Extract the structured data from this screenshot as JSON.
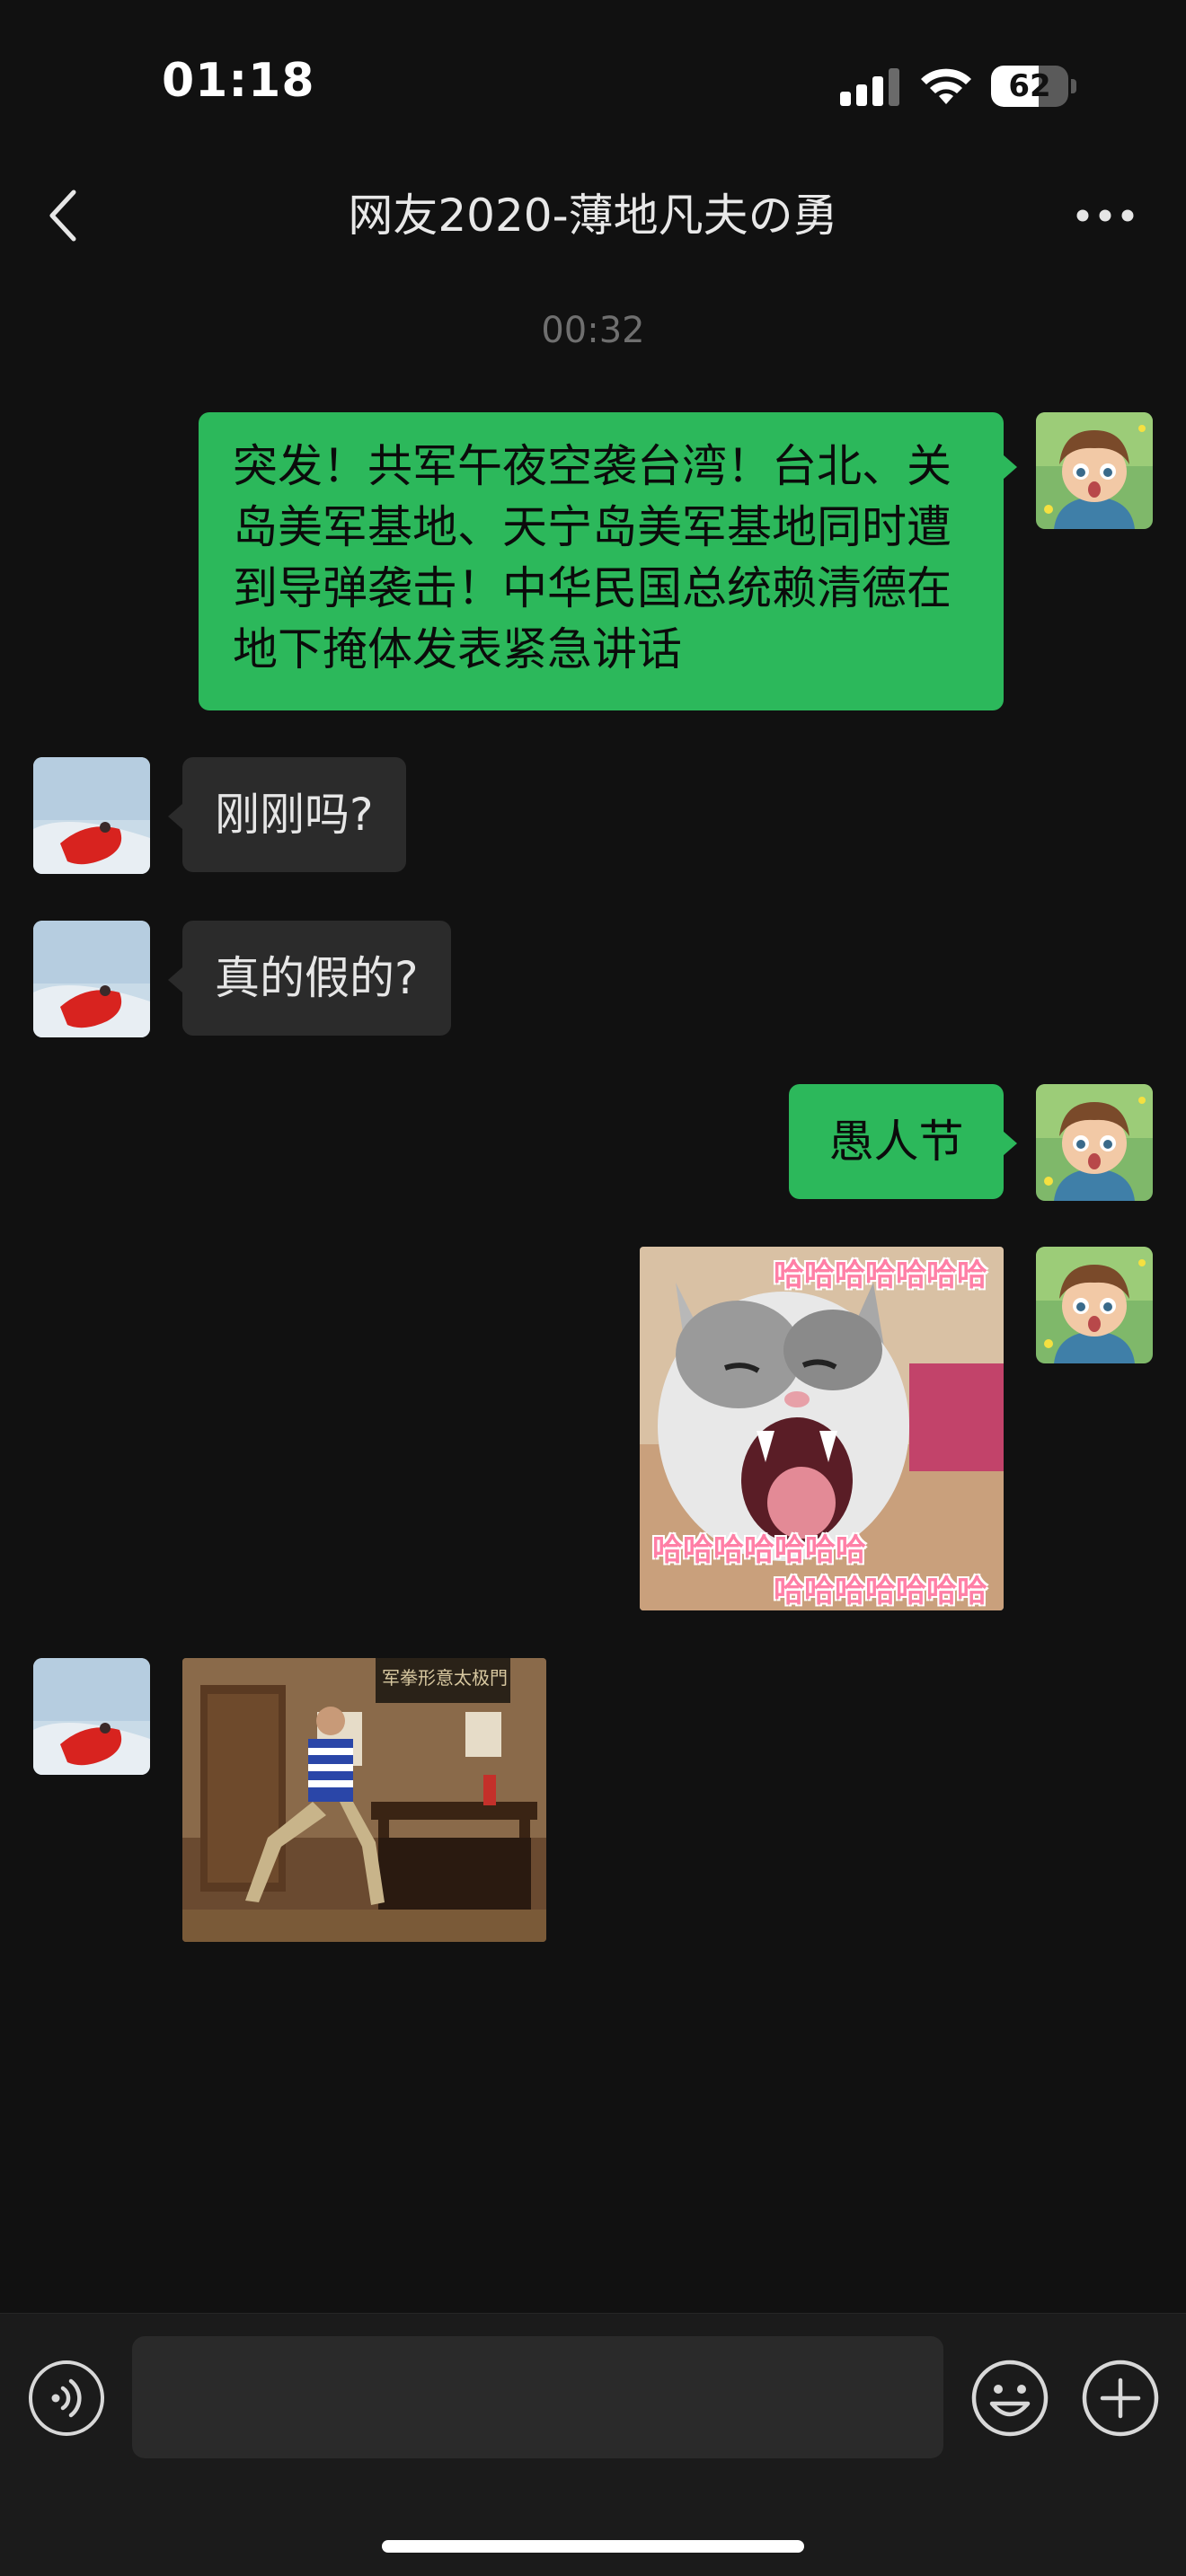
{
  "status_bar": {
    "time": "01:18",
    "battery_level": "62",
    "icons": [
      "signal-icon",
      "wifi-icon",
      "battery-icon"
    ]
  },
  "nav": {
    "title": "网友2020-薄地凡夫の勇",
    "icons": [
      "chevron-left-icon",
      "more-icon"
    ]
  },
  "chat": {
    "timestamp": "00:32",
    "messages": [
      {
        "direction": "out",
        "type": "text",
        "text": "突发！共军午夜空袭台湾！台北、关岛美军基地、天宁岛美军基地同时遭到导弹袭击！中华民国总统赖清德在地下掩体发表紧急讲话"
      },
      {
        "direction": "in",
        "type": "text",
        "text": "刚刚吗?"
      },
      {
        "direction": "in",
        "type": "text",
        "text": "真的假的?"
      },
      {
        "direction": "out",
        "type": "text",
        "text": "愚人节"
      },
      {
        "direction": "out",
        "type": "sticker",
        "captions": [
          "哈哈哈哈哈哈哈",
          "哈哈哈哈哈哈哈",
          "哈哈哈哈哈哈哈"
        ]
      },
      {
        "direction": "in",
        "type": "image",
        "caption": "军拳形意太极門"
      }
    ]
  },
  "input_bar": {
    "placeholder": "",
    "icons": [
      "voice-icon",
      "emoji-icon",
      "add-icon"
    ]
  },
  "colors": {
    "background": "#111111",
    "outgoing_bubble": "#2cb85b",
    "incoming_bubble": "#2b2b2b",
    "input_bar": "#1b1b1b"
  }
}
